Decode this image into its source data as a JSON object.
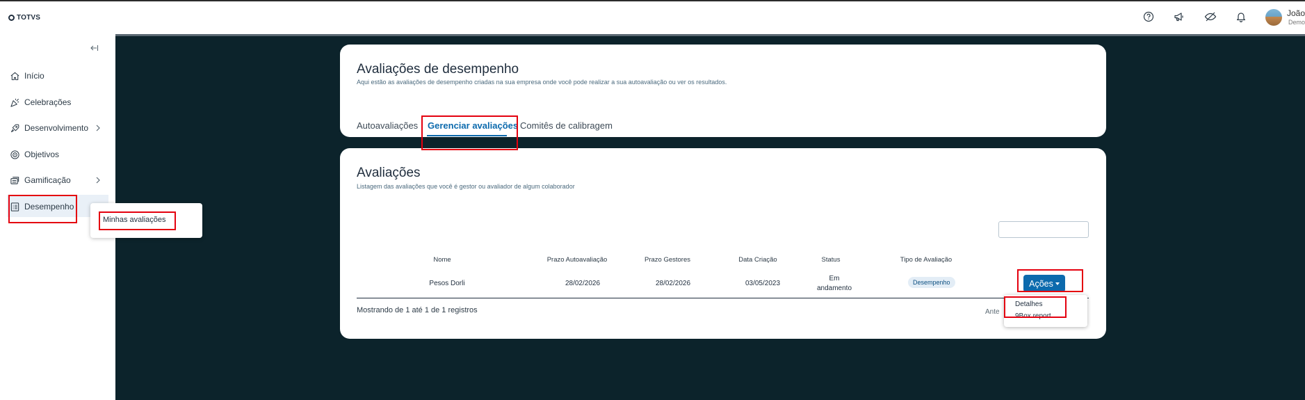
{
  "header": {
    "logo_text": "TOTVS",
    "user_name": "João",
    "user_subtitle": "Demo",
    "icons": [
      "help-icon",
      "megaphone-icon",
      "eye-off-icon",
      "bell-icon"
    ]
  },
  "sidebar": {
    "items": [
      {
        "label": "Início",
        "icon": "home-icon"
      },
      {
        "label": "Celebrações",
        "icon": "party-popper-icon"
      },
      {
        "label": "Desenvolvimento",
        "icon": "rocket-icon",
        "has_children": true
      },
      {
        "label": "Objetivos",
        "icon": "target-icon"
      },
      {
        "label": "Gamificação",
        "icon": "cards-icon",
        "has_children": true
      },
      {
        "label": "Desempenho",
        "icon": "clipboard-list-icon",
        "active": true
      }
    ],
    "flyout": {
      "items": [
        "Minhas avaliações"
      ]
    }
  },
  "page": {
    "title": "Avaliações de desempenho",
    "subtitle": "Aqui estão as avaliações de desempenho criadas na sua empresa onde você pode realizar a sua autoavaliação ou ver os resultados.",
    "tabs": [
      {
        "label": "Autoavaliações",
        "active": false
      },
      {
        "label": "Gerenciar avaliações",
        "active": true
      },
      {
        "label": "Comitês de calibragem",
        "active": false
      }
    ]
  },
  "evaluations": {
    "title": "Avaliações",
    "subtitle": "Listagem das avaliações que você é gestor ou avaliador de algum colaborador",
    "search_value": "",
    "columns": [
      "Nome",
      "Prazo Autoavaliação",
      "Prazo Gestores",
      "Data Criação",
      "Status",
      "Tipo de Avaliação"
    ],
    "rows": [
      {
        "nome": "Pesos Dorli",
        "prazo_autoavaliacao": "28/02/2026",
        "prazo_gestores": "28/02/2026",
        "data_criacao": "03/05/2023",
        "status_line1": "Em",
        "status_line2": "andamento",
        "tipo": "Desempenho",
        "action_label": "Ações"
      }
    ],
    "actions_menu": [
      "Detalhes",
      "9Box report"
    ],
    "footer": "Mostrando de 1 até 1 de 1 registros",
    "pager_prev": "Ante"
  },
  "colors": {
    "brand_dark": "#0c232b",
    "accent": "#0c6aad",
    "highlight": "#e4000f"
  }
}
